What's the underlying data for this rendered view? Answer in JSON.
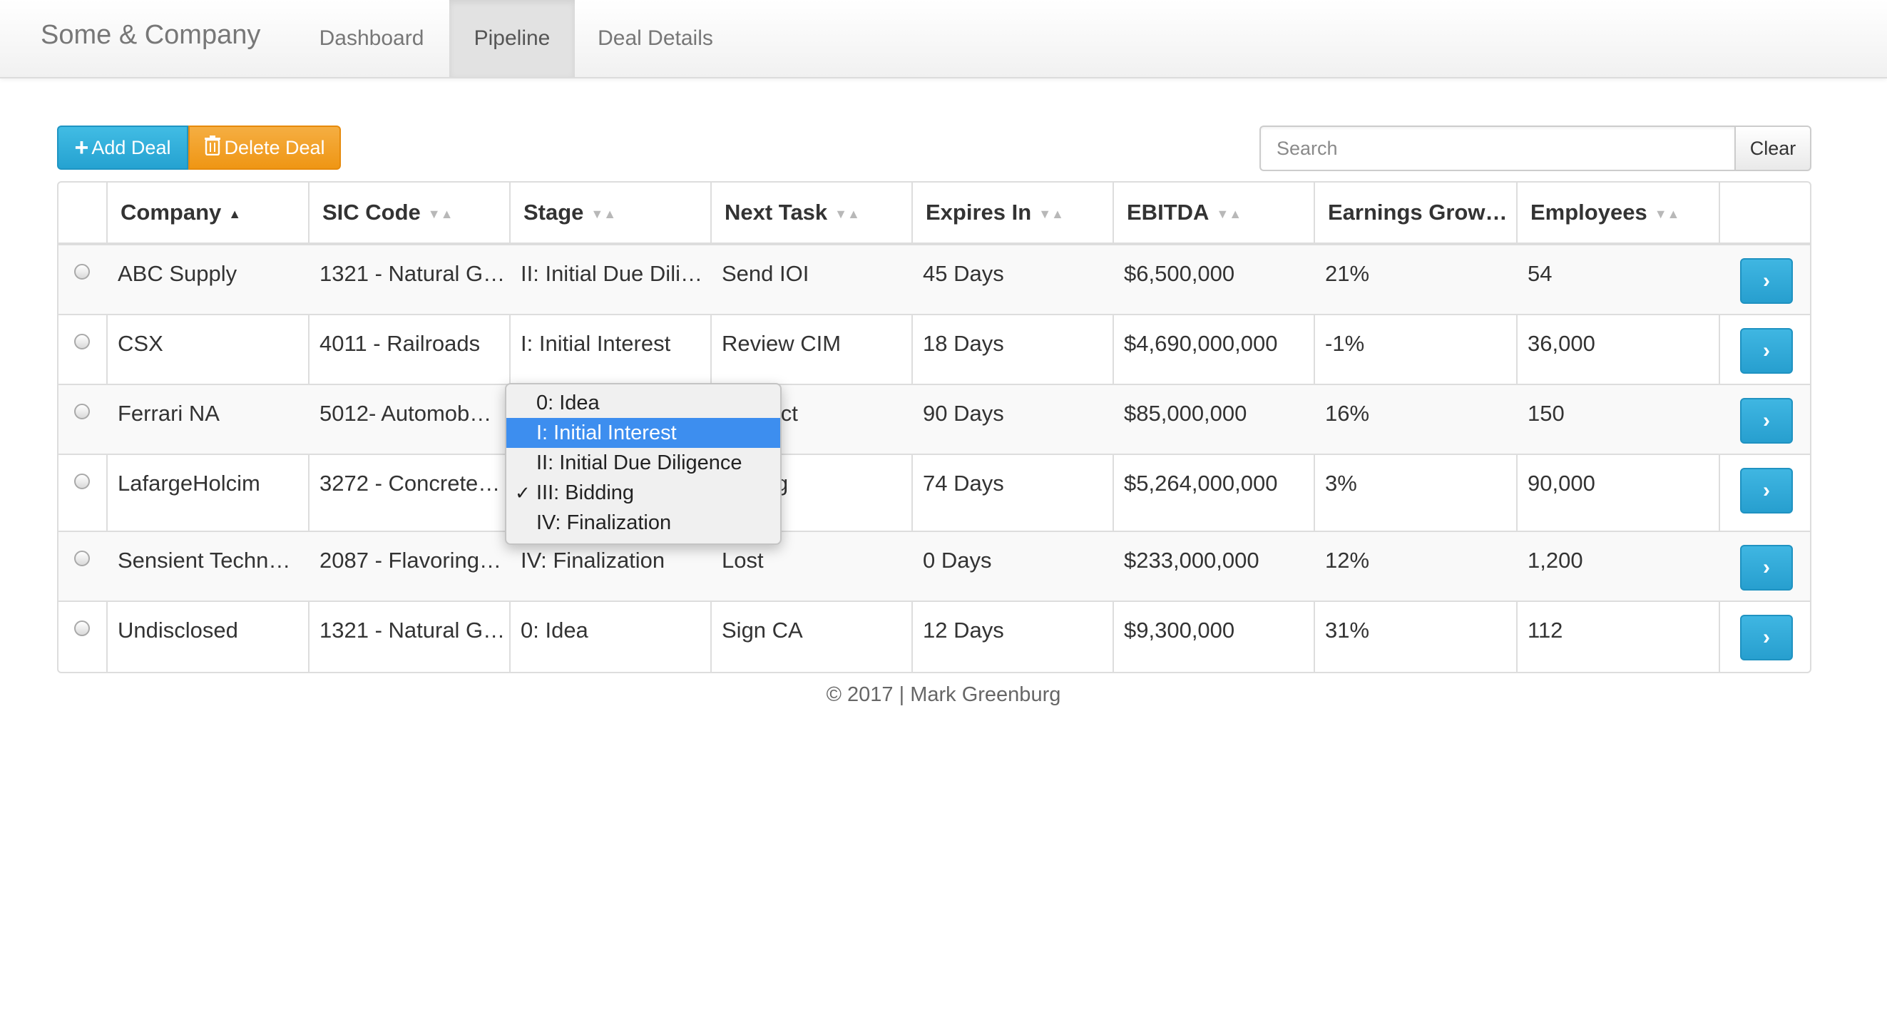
{
  "navbar": {
    "brand": "Some & Company",
    "tabs": [
      {
        "label": "Dashboard",
        "active": false
      },
      {
        "label": "Pipeline",
        "active": true
      },
      {
        "label": "Deal Details",
        "active": false
      }
    ]
  },
  "toolbar": {
    "add_label": "Add Deal",
    "delete_label": "Delete Deal",
    "search_placeholder": "Search",
    "clear_label": "Clear"
  },
  "table": {
    "columns": [
      {
        "label": "Company",
        "sort": "asc"
      },
      {
        "label": "SIC Code",
        "sort": "none"
      },
      {
        "label": "Stage",
        "sort": "none"
      },
      {
        "label": "Next Task",
        "sort": "none"
      },
      {
        "label": "Expires In",
        "sort": "none"
      },
      {
        "label": "EBITDA",
        "sort": "none"
      },
      {
        "label": "Earnings Grow…",
        "sort": "none"
      },
      {
        "label": "Employees",
        "sort": "none"
      }
    ],
    "rows": [
      {
        "company": "ABC Supply",
        "sic": "1321 - Natural G…",
        "stage": "II: Initial Due Dili…",
        "task": "Send IOI",
        "expires": "45 Days",
        "ebitda": "$6,500,000",
        "growth": "21%",
        "employees": "54"
      },
      {
        "company": "CSX",
        "sic": "4011 - Railroads",
        "stage": "I: Initial Interest",
        "task": "Review CIM",
        "expires": "18 Days",
        "ebitda": "$4,690,000,000",
        "growth": "-1%",
        "employees": "36,000"
      },
      {
        "company": "Ferrari NA",
        "sic": "5012- Automob…",
        "stage": "",
        "task": "Contact",
        "expires": "90 Days",
        "ebitda": "$85,000,000",
        "growth": "16%",
        "employees": "150"
      },
      {
        "company": "LafargeHolcim",
        "sic": "3272 - Concrete…",
        "stage": "",
        "task": "ending",
        "expires": "74 Days",
        "ebitda": "$5,264,000,000",
        "growth": "3%",
        "employees": "90,000"
      },
      {
        "company": "Sensient Techn…",
        "sic": "2087 - Flavoring…",
        "stage": "IV: Finalization",
        "task": "Lost",
        "expires": "0 Days",
        "ebitda": "$233,000,000",
        "growth": "12%",
        "employees": "1,200"
      },
      {
        "company": "Undisclosed",
        "sic": "1321 - Natural G…",
        "stage": "0: Idea",
        "task": "Sign CA",
        "expires": "12 Days",
        "ebitda": "$9,300,000",
        "growth": "31%",
        "employees": "112"
      }
    ]
  },
  "stage_dropdown": {
    "options": [
      "0: Idea",
      "I: Initial Interest",
      "II: Initial Due Diligence",
      "III: Bidding",
      "IV: Finalization"
    ],
    "highlighted": "I: Initial Interest",
    "checked": "III: Bidding"
  },
  "footer": {
    "text": "© 2017 | Mark Greenburg"
  },
  "icons": {
    "plus": "plus-icon",
    "trash": "trash-icon",
    "sort": "sort-icon",
    "chevron": "chevron-right-icon",
    "check": "checkmark-icon"
  },
  "colors": {
    "primary": "#2aa7d6",
    "warning": "#f0a02a",
    "highlight": "#3d8eef"
  }
}
